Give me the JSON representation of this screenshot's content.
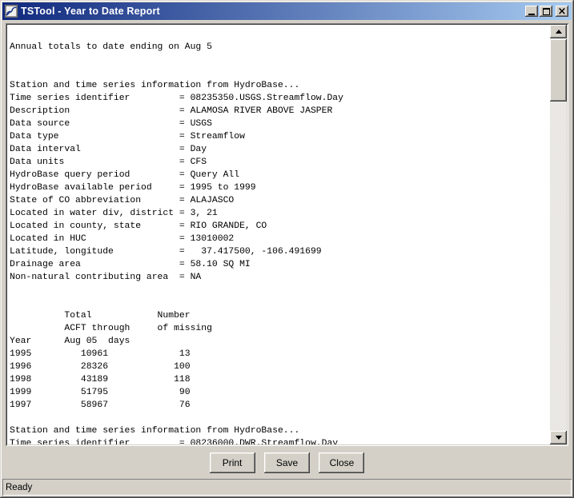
{
  "window": {
    "title": "TSTool - Year to Date Report",
    "close_glyph": "×"
  },
  "report": {
    "lines": [
      "",
      "Annual totals to date ending on Aug 5",
      "",
      "",
      "Station and time series information from HydroBase...",
      "Time series identifier         = 08235350.USGS.Streamflow.Day",
      "Description                    = ALAMOSA RIVER ABOVE JASPER",
      "Data source                    = USGS",
      "Data type                      = Streamflow",
      "Data interval                  = Day",
      "Data units                     = CFS",
      "HydroBase query period         = Query All",
      "HydroBase available period     = 1995 to 1999",
      "State of CO abbreviation       = ALAJASCO",
      "Located in water div, district = 3, 21",
      "Located in county, state       = RIO GRANDE, CO",
      "Located in HUC                 = 13010002",
      "Latitude, longitude            =   37.417500, -106.491699",
      "Drainage area                  = 58.10 SQ MI",
      "Non-natural contributing area  = NA",
      "",
      "",
      "          Total            Number",
      "          ACFT through     of missing",
      "Year      Aug 05  days",
      "1995         10961             13",
      "1996         28326            100",
      "1998         43189            118",
      "1999         51795             90",
      "1997         58967             76",
      "",
      "Station and time series information from HydroBase...",
      "Time series identifier         = 08236000.DWR.Streamflow.Day"
    ],
    "annual_totals_table": {
      "columns": [
        "Year",
        "Total ACFT through Aug 05",
        "Number of missing days"
      ],
      "rows": [
        [
          1995,
          10961,
          13
        ],
        [
          1996,
          28326,
          100
        ],
        [
          1998,
          43189,
          118
        ],
        [
          1999,
          51795,
          90
        ],
        [
          1997,
          58967,
          76
        ]
      ]
    }
  },
  "buttons": {
    "print": "Print",
    "save": "Save",
    "close": "Close"
  },
  "statusbar": {
    "text": "Ready"
  },
  "colors": {
    "titlebar_left": "#10297e",
    "titlebar_right": "#a6caf0",
    "titlebar_text": "#ffffff",
    "window_face": "#d4d0c8"
  }
}
